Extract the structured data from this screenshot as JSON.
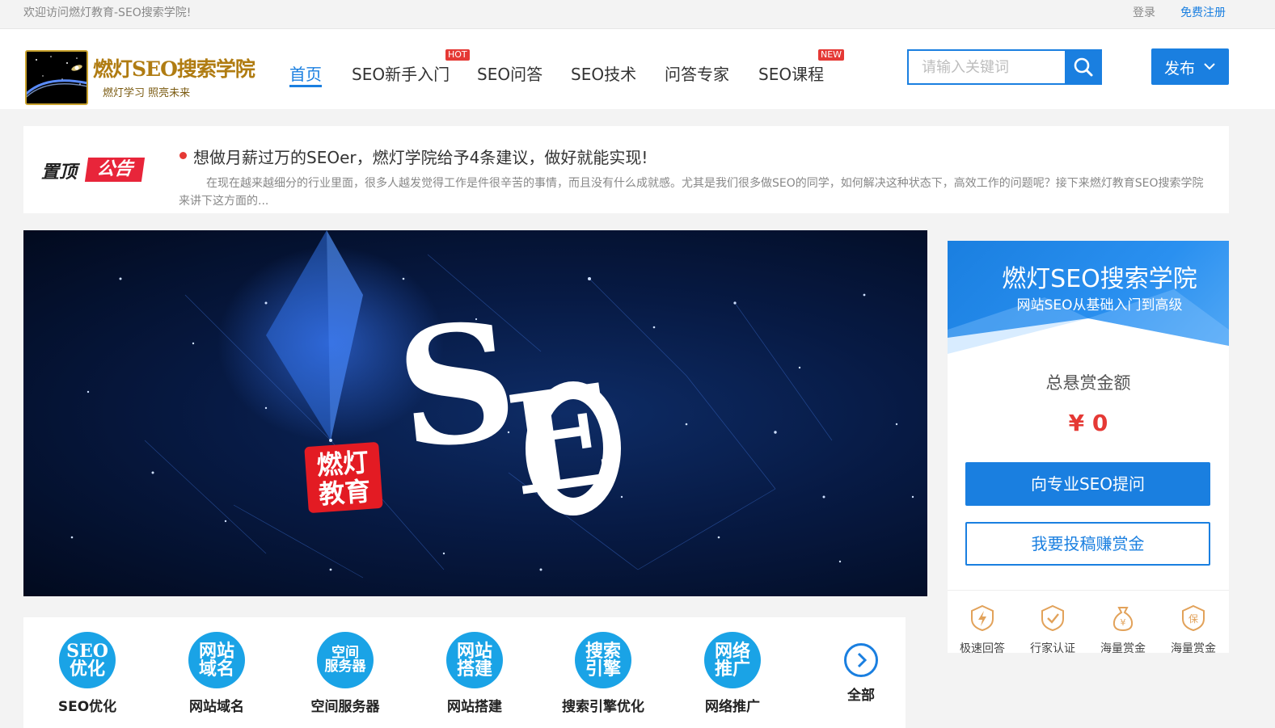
{
  "topbar": {
    "welcome": "欢迎访问燃灯教育-SEO搜索学院!",
    "login": "登录",
    "register": "免费注册"
  },
  "header": {
    "logo_title": "燃灯SEO搜索学院",
    "logo_sub": "燃灯学习  照亮未来",
    "nav": [
      {
        "label": "首页",
        "active": true
      },
      {
        "label": "SEO新手入门",
        "badge": "HOT"
      },
      {
        "label": "SEO问答"
      },
      {
        "label": "SEO技术"
      },
      {
        "label": "问答专家"
      },
      {
        "label": "SEO课程",
        "badge": "NEW"
      }
    ],
    "search_placeholder": "请输入关键词",
    "publish": "发布"
  },
  "notice": {
    "badge_left": "置顶",
    "badge_right": "公告",
    "title": "想做月薪过万的SEOer，燃灯学院给予4条建议，做好就能实现!",
    "desc": "在现在越来越细分的行业里面，很多人越发觉得工作是件很辛苦的事情，而且没有什么成就感。尤其是我们很多做SEO的同学，如何解决这种状态下，高效工作的问题呢？接下来燃灯教育SEO搜索学院来讲下这方面的..."
  },
  "banner": {
    "big_text": "SEO",
    "stamp_line1": "燃灯",
    "stamp_line2": "教育"
  },
  "panel": {
    "title": "燃灯SEO搜索学院",
    "subtitle": "网站SEO从基础入门到高级",
    "amount_label": "总悬赏金额",
    "amount": "¥ 0",
    "ask_button": "向专业SEO提问",
    "submit_button": "我要投稿赚赏金",
    "features": [
      {
        "icon": "lightning-shield-icon",
        "label": "极速回答"
      },
      {
        "icon": "check-shield-icon",
        "label": "行家认证"
      },
      {
        "icon": "money-bag-icon",
        "label": "海量赏金"
      },
      {
        "icon": "guarantee-shield-icon",
        "label": "海量赏金",
        "glyph": "保"
      }
    ]
  },
  "categories": {
    "items": [
      {
        "line1": "SEO",
        "line2": "优化",
        "label": "SEO优化"
      },
      {
        "line1": "网站",
        "line2": "域名",
        "label": "网站域名"
      },
      {
        "line1": "空间",
        "line2": "服务器",
        "label": "空间服务器",
        "small": true
      },
      {
        "line1": "网站",
        "line2": "搭建",
        "label": "网站搭建"
      },
      {
        "line1": "搜索",
        "line2": "引擎",
        "label": "搜索引擎优化"
      },
      {
        "line1": "网络",
        "line2": "推广",
        "label": "网络推广"
      }
    ],
    "all_label": "全部"
  },
  "colors": {
    "brand_blue": "#1a7fe0",
    "accent_red": "#e53935",
    "category_circle": "#1aa3e6"
  }
}
